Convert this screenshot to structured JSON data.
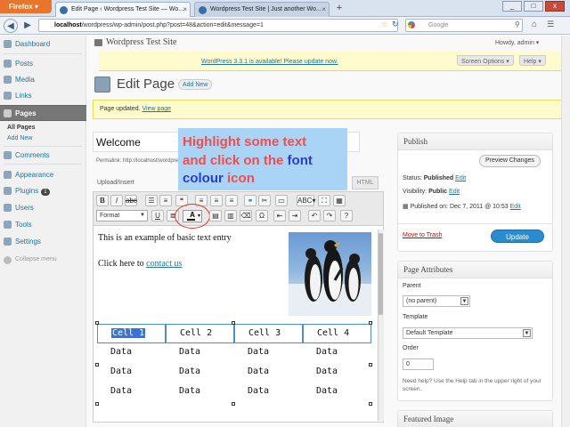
{
  "browser": {
    "app_button": "Firefox",
    "tabs": [
      {
        "label": "Edit Page ‹ Wordpress Test Site — Wo...",
        "active": true
      },
      {
        "label": "Wordpress Test Site | Just another Wo...",
        "active": false
      }
    ],
    "new_tab": "+",
    "url_prefix": "localhost",
    "url_rest": "/wordpress/wp-admin/post.php?post=48&action=edit&message=1",
    "search_placeholder": "Google",
    "window_controls": [
      "_",
      "□",
      "x"
    ]
  },
  "wp": {
    "site_name": "Wordpress Test Site",
    "howdy": "Howdy, admin ▾",
    "update_notice": "WordPress 3.3.1 is available! Please update now.",
    "screen_options": "Screen Options ▾",
    "help": "Help ▾",
    "sidebar": {
      "items": [
        {
          "label": "Dashboard"
        },
        {
          "label": "Posts"
        },
        {
          "label": "Media"
        },
        {
          "label": "Links"
        },
        {
          "label": "Pages"
        },
        {
          "label": "Comments"
        },
        {
          "label": "Appearance"
        },
        {
          "label": "Plugins"
        },
        {
          "label": "Users"
        },
        {
          "label": "Tools"
        },
        {
          "label": "Settings"
        },
        {
          "label": "Collapse menu"
        }
      ],
      "submenu": [
        "All Pages",
        "Add New"
      ],
      "plugins_badge": "1"
    },
    "page_title": "Edit Page",
    "add_new": "Add New",
    "updated_msg": "Page updated.",
    "updated_link": "View page",
    "title_value": "Welcome",
    "permalink": "Permalink: http://localhost/wordpress/?page_id=48",
    "upload_insert": "Upload/Insert",
    "html_tab": "HTML",
    "format_select": "Format",
    "editor": {
      "para1": "This is an example of basic text entry",
      "para2_prefix": "Click here to",
      "para2_link": "contact us",
      "table": {
        "header": [
          "Cell 1",
          "Cell 2",
          "Cell 3",
          "Cell 4"
        ],
        "rows": [
          [
            "Data",
            "Data",
            "Data",
            "Data"
          ],
          [
            "Data",
            "Data",
            "Data",
            "Data"
          ],
          [
            "Data",
            "Data",
            "Data",
            "Data"
          ]
        ]
      }
    },
    "callout": {
      "line1": "Highlight some text",
      "line2": "and click on the",
      "line2_blue": "font",
      "line3_blue": "colour",
      "line3": "icon"
    },
    "publish": {
      "title": "Publish",
      "preview": "Preview Changes",
      "status_label": "Status:",
      "status_value": "Published",
      "visibility_label": "Visibility:",
      "visibility_value": "Public",
      "published_on": "Published on: Dec 7, 2011 @ 10:53",
      "edit": "Edit",
      "trash": "Move to Trash",
      "update": "Update"
    },
    "attributes": {
      "title": "Page Attributes",
      "parent_label": "Parent",
      "parent_value": "(no parent)",
      "template_label": "Template",
      "template_value": "Default Template",
      "order_label": "Order",
      "order_value": "0",
      "help_text": "Need help? Use the Help tab in the upper right of your screen."
    },
    "featured_image": "Featured Image"
  }
}
